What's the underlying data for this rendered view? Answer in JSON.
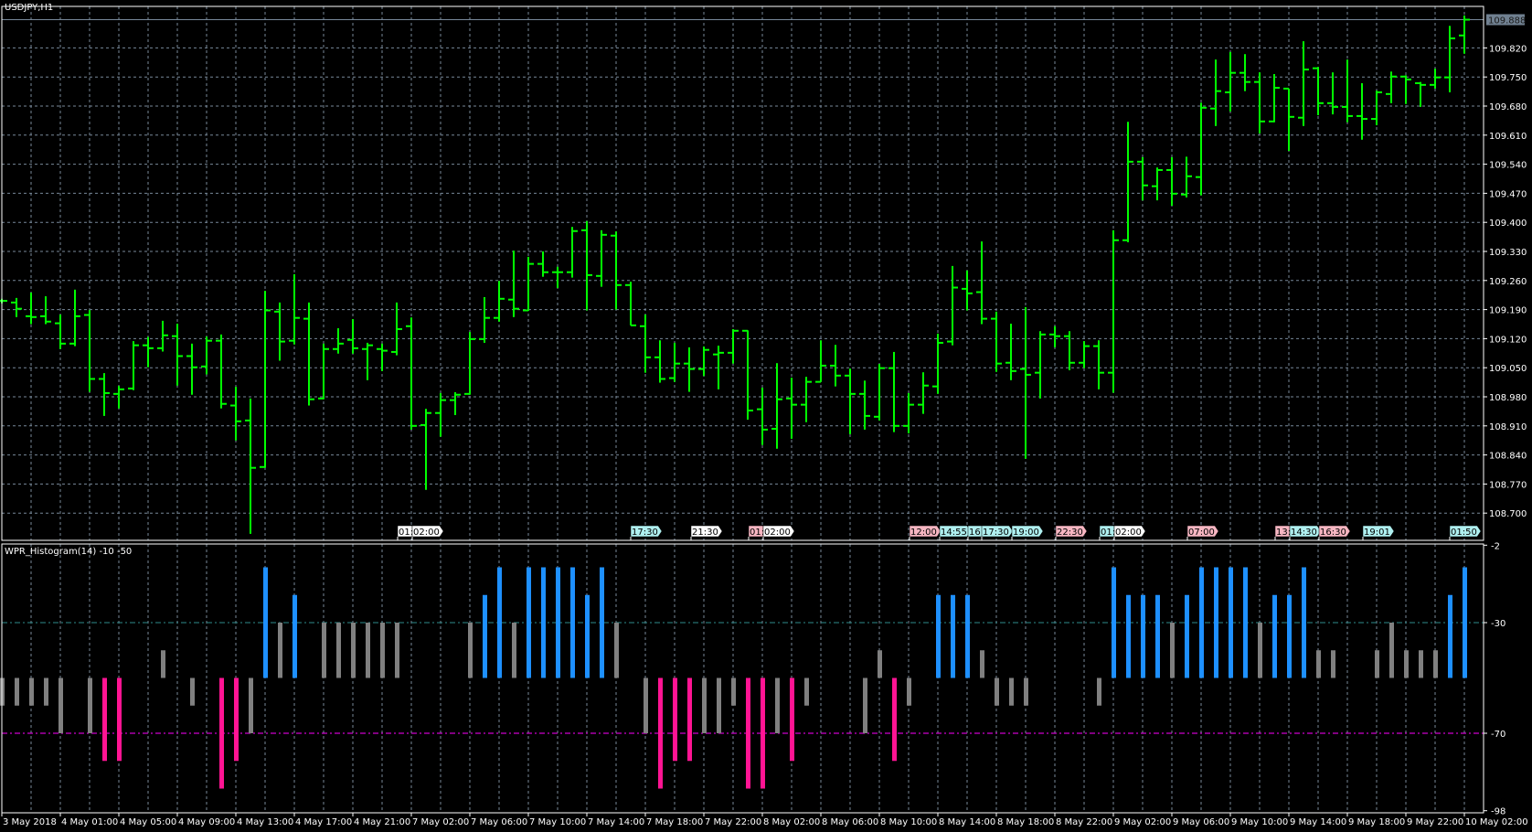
{
  "chart": {
    "symbol_title": "USDJPY,H1",
    "current_price": "109.888",
    "price_labels": [
      "109.820",
      "109.750",
      "109.680",
      "109.610",
      "109.540",
      "109.470",
      "109.400",
      "109.330",
      "109.260",
      "109.190",
      "109.120",
      "109.050",
      "108.980",
      "108.910",
      "108.840",
      "108.770",
      "108.700"
    ],
    "time_labels": [
      "3 May 2018",
      "4 May 01:00",
      "4 May 05:00",
      "4 May 09:00",
      "4 May 13:00",
      "4 May 17:00",
      "4 May 21:00",
      "7 May 02:00",
      "7 May 06:00",
      "7 May 10:00",
      "7 May 14:00",
      "7 May 18:00",
      "7 May 22:00",
      "8 May 02:00",
      "8 May 06:00",
      "8 May 10:00",
      "8 May 14:00",
      "8 May 18:00",
      "8 May 22:00",
      "9 May 02:00",
      "9 May 06:00",
      "9 May 10:00",
      "9 May 14:00",
      "9 May 18:00",
      "9 May 22:00",
      "10 May 02:00"
    ],
    "events": [
      {
        "text": "01:",
        "type": "white"
      },
      {
        "text": "02:00",
        "type": "white"
      },
      {
        "text": "17:30",
        "type": "cyan"
      },
      {
        "text": "21:30",
        "type": "white"
      },
      {
        "text": "01:",
        "type": "pink"
      },
      {
        "text": "02:00",
        "type": "white"
      },
      {
        "text": "12:00",
        "type": "pink"
      },
      {
        "text": "14:55",
        "type": "cyan"
      },
      {
        "text": "16:",
        "type": "cyan"
      },
      {
        "text": "17:30",
        "type": "cyan"
      },
      {
        "text": "19:00",
        "type": "cyan"
      },
      {
        "text": "22:30",
        "type": "pink"
      },
      {
        "text": "01:",
        "type": "cyan"
      },
      {
        "text": "02:00",
        "type": "white"
      },
      {
        "text": "07:00",
        "type": "pink"
      },
      {
        "text": "13:",
        "type": "pink"
      },
      {
        "text": "14:30",
        "type": "cyan"
      },
      {
        "text": "16:30",
        "type": "pink"
      },
      {
        "text": "19:01",
        "type": "cyan"
      },
      {
        "text": "01:50",
        "type": "cyan"
      }
    ],
    "colors": {
      "bar": "#00ff00",
      "grid": "#778899",
      "white": "#ffffff",
      "cyan": "#aff0f0",
      "pink": "#f7b6c2",
      "up": "#1e90ff",
      "down": "#ff1493",
      "neutral": "#808080",
      "level_high": "#2e8b8b",
      "level_low": "#ff00ff"
    }
  },
  "indicator": {
    "title": "WPR_Histogram(14) -10 -50",
    "axis_labels": [
      "-2",
      "-30",
      "-70",
      "-98"
    ]
  },
  "chart_data": {
    "type": "ohlc",
    "title": "USDJPY,H1",
    "ylim": [
      108.63,
      109.92
    ],
    "ohlc": [
      [
        109.211,
        109.216,
        109.205,
        109.211
      ],
      [
        109.207,
        109.218,
        109.172,
        109.192
      ],
      [
        109.174,
        109.231,
        109.155,
        109.172
      ],
      [
        109.174,
        109.222,
        109.155,
        109.161
      ],
      [
        109.157,
        109.178,
        109.095,
        109.108
      ],
      [
        109.108,
        109.238,
        109.102,
        109.174
      ],
      [
        109.177,
        109.189,
        108.992,
        109.023
      ],
      [
        109.023,
        109.037,
        108.934,
        108.989
      ],
      [
        108.987,
        109.006,
        108.952,
        108.998
      ],
      [
        109.0,
        109.114,
        108.996,
        109.104
      ],
      [
        109.104,
        109.124,
        109.051,
        109.097
      ],
      [
        109.097,
        109.163,
        109.089,
        109.128
      ],
      [
        109.126,
        109.156,
        109.007,
        109.078
      ],
      [
        109.078,
        109.108,
        108.985,
        109.051
      ],
      [
        109.053,
        109.125,
        109.034,
        109.115
      ],
      [
        109.115,
        109.13,
        108.952,
        108.963
      ],
      [
        108.959,
        109.004,
        108.875,
        108.921
      ],
      [
        108.923,
        108.976,
        108.65,
        108.809
      ],
      [
        108.811,
        109.235,
        108.809,
        109.188
      ],
      [
        109.185,
        109.207,
        109.067,
        109.113
      ],
      [
        109.115,
        109.275,
        109.106,
        109.17
      ],
      [
        109.168,
        109.207,
        108.959,
        108.974
      ],
      [
        108.976,
        109.108,
        108.974,
        109.095
      ],
      [
        109.095,
        109.145,
        109.084,
        109.108
      ],
      [
        109.117,
        109.167,
        109.084,
        109.097
      ],
      [
        109.095,
        109.11,
        109.02,
        109.104
      ],
      [
        109.095,
        109.108,
        109.042,
        109.091
      ],
      [
        109.088,
        109.207,
        109.08,
        109.143
      ],
      [
        109.15,
        109.171,
        108.901,
        108.91
      ],
      [
        108.912,
        108.951,
        108.756,
        108.941
      ],
      [
        108.941,
        108.989,
        108.884,
        108.972
      ],
      [
        108.972,
        108.991,
        108.936,
        108.985
      ],
      [
        108.987,
        109.136,
        108.985,
        109.119
      ],
      [
        109.119,
        109.22,
        109.11,
        109.17
      ],
      [
        109.17,
        109.259,
        109.161,
        109.216
      ],
      [
        109.214,
        109.332,
        109.172,
        109.192
      ],
      [
        109.188,
        109.317,
        109.187,
        109.3
      ],
      [
        109.3,
        109.33,
        109.269,
        109.28
      ],
      [
        109.28,
        109.293,
        109.242,
        109.28
      ],
      [
        109.28,
        109.389,
        109.267,
        109.379
      ],
      [
        109.381,
        109.403,
        109.188,
        109.273
      ],
      [
        109.271,
        109.381,
        109.245,
        109.37
      ],
      [
        109.368,
        109.378,
        109.19,
        109.249
      ],
      [
        109.249,
        109.257,
        109.152,
        109.152
      ],
      [
        109.15,
        109.178,
        109.038,
        109.075
      ],
      [
        109.075,
        109.116,
        109.014,
        109.023
      ],
      [
        109.025,
        109.11,
        109.016,
        109.06
      ],
      [
        109.06,
        109.099,
        108.992,
        109.047
      ],
      [
        109.047,
        109.101,
        109.03,
        109.093
      ],
      [
        109.082,
        109.103,
        108.998,
        109.086
      ],
      [
        109.086,
        109.143,
        109.06,
        109.139
      ],
      [
        109.139,
        109.14,
        108.925,
        108.947
      ],
      [
        108.95,
        109.002,
        108.864,
        108.901
      ],
      [
        108.903,
        109.061,
        108.855,
        108.974
      ],
      [
        108.976,
        109.026,
        108.879,
        108.961
      ],
      [
        108.961,
        109.028,
        108.919,
        109.016
      ],
      [
        109.016,
        109.116,
        109.016,
        109.055
      ],
      [
        109.055,
        109.105,
        109.005,
        109.031
      ],
      [
        109.031,
        109.048,
        108.89,
        108.987
      ],
      [
        108.987,
        109.019,
        108.901,
        108.934
      ],
      [
        108.932,
        109.059,
        108.923,
        109.049
      ],
      [
        109.049,
        109.088,
        108.895,
        108.91
      ],
      [
        108.91,
        108.989,
        108.892,
        108.961
      ],
      [
        108.961,
        109.039,
        108.939,
        109.007
      ],
      [
        109.005,
        109.132,
        108.987,
        109.11
      ],
      [
        109.113,
        109.295,
        109.104,
        109.243
      ],
      [
        109.24,
        109.284,
        109.188,
        109.229
      ],
      [
        109.232,
        109.354,
        109.155,
        109.168
      ],
      [
        109.168,
        109.185,
        109.04,
        109.06
      ],
      [
        109.062,
        109.156,
        109.02,
        109.042
      ],
      [
        109.047,
        109.196,
        108.831,
        109.033
      ],
      [
        109.038,
        109.138,
        108.976,
        109.13
      ],
      [
        109.13,
        109.15,
        109.099,
        109.126
      ],
      [
        109.126,
        109.138,
        109.044,
        109.062
      ],
      [
        109.062,
        109.114,
        109.049,
        109.102
      ],
      [
        109.102,
        109.116,
        108.998,
        109.038
      ],
      [
        109.038,
        109.381,
        108.99,
        109.357
      ],
      [
        109.357,
        109.642,
        109.352,
        109.546
      ],
      [
        109.546,
        109.557,
        109.453,
        109.489
      ],
      [
        109.487,
        109.532,
        109.453,
        109.526
      ],
      [
        109.526,
        109.557,
        109.44,
        109.469
      ],
      [
        109.467,
        109.558,
        109.46,
        109.511
      ],
      [
        109.509,
        109.688,
        109.465,
        109.676
      ],
      [
        109.674,
        109.792,
        109.632,
        109.716
      ],
      [
        109.713,
        109.81,
        109.667,
        109.76
      ],
      [
        109.76,
        109.805,
        109.716,
        109.738
      ],
      [
        109.738,
        109.761,
        109.614,
        109.643
      ],
      [
        109.643,
        109.757,
        109.641,
        109.724
      ],
      [
        109.722,
        109.722,
        109.572,
        109.654
      ],
      [
        109.652,
        109.836,
        109.632,
        109.768
      ],
      [
        109.771,
        109.774,
        109.658,
        109.687
      ],
      [
        109.687,
        109.761,
        109.66,
        109.678
      ],
      [
        109.678,
        109.792,
        109.641,
        109.656
      ],
      [
        109.656,
        109.735,
        109.599,
        109.649
      ],
      [
        109.649,
        109.717,
        109.634,
        109.713
      ],
      [
        109.709,
        109.763,
        109.687,
        109.751
      ],
      [
        109.751,
        109.754,
        109.685,
        109.744
      ],
      [
        109.735,
        109.738,
        109.678,
        109.731
      ],
      [
        109.731,
        109.77,
        109.722,
        109.749
      ],
      [
        109.749,
        109.873,
        109.713,
        109.843
      ],
      [
        109.85,
        109.898,
        109.806,
        109.888
      ]
    ],
    "wpr_histogram": {
      "type": "bar",
      "base": -50,
      "levels": [
        -30,
        -70
      ],
      "ylim": [
        -98,
        -2
      ],
      "values": [
        -60,
        -60,
        -60,
        -60,
        -70,
        -50,
        -70,
        -80,
        -80,
        -50,
        -50,
        -40,
        -50,
        -60,
        -50,
        -90,
        -80,
        -70,
        -10,
        -30,
        -20,
        -50,
        -30,
        -30,
        -30,
        -30,
        -30,
        -30,
        -50,
        -50,
        -50,
        -50,
        -30,
        -20,
        -10,
        -30,
        -10,
        -10,
        -10,
        -10,
        -20,
        -10,
        -30,
        -50,
        -70,
        -90,
        -80,
        -80,
        -70,
        -70,
        -60,
        -90,
        -90,
        -70,
        -80,
        -60,
        -50,
        -50,
        -50,
        -70,
        -40,
        -80,
        -60,
        -50,
        -20,
        -20,
        -20,
        -40,
        -60,
        -60,
        -60,
        -50,
        -50,
        -50,
        -50,
        -60,
        -10,
        -20,
        -20,
        -20,
        -30,
        -20,
        -10,
        -10,
        -10,
        -10,
        -30,
        -20,
        -20,
        -10,
        -40,
        -40,
        -50,
        -50,
        -40,
        -30,
        -40,
        -40,
        -40,
        -20,
        -10
      ]
    }
  }
}
